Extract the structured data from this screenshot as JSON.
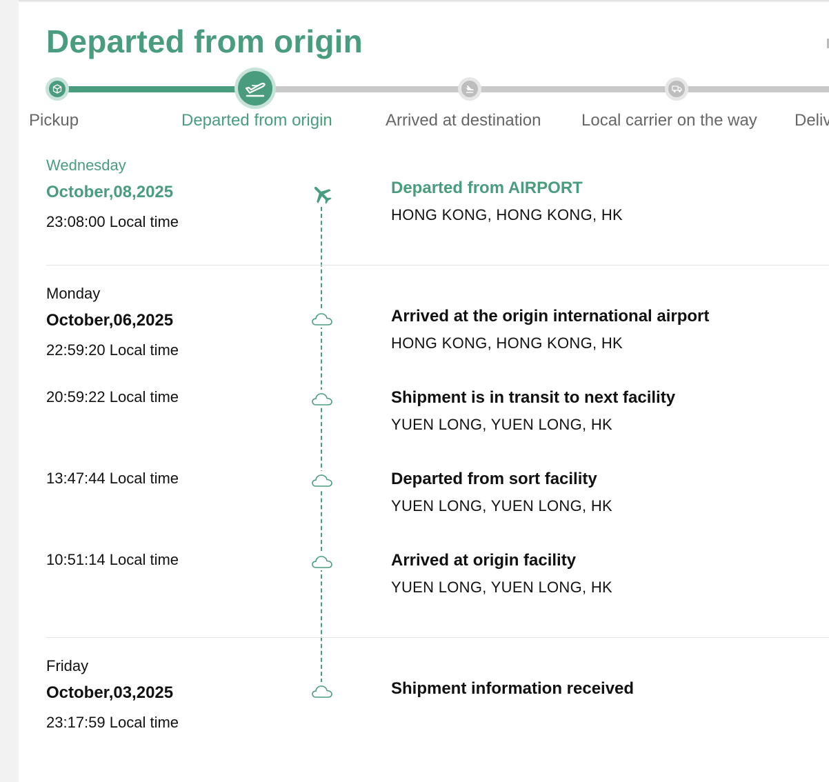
{
  "header": {
    "title": "Departed from origin"
  },
  "progress": {
    "current_step": 2,
    "steps": [
      {
        "label": "Pickup",
        "icon": "package-icon",
        "status": "done"
      },
      {
        "label": "Departed from origin",
        "icon": "plane-takeoff-icon",
        "status": "current"
      },
      {
        "label": "Arrived at destination",
        "icon": "plane-landing-icon",
        "status": "pending"
      },
      {
        "label": "Local carrier on the way",
        "icon": "truck-icon",
        "status": "pending"
      },
      {
        "label": "Deliv",
        "icon": "delivered-icon",
        "status": "pending"
      }
    ]
  },
  "timeline": {
    "groups": [
      {
        "weekday": "Wednesday",
        "date": "October,08,2025",
        "events": [
          {
            "time": "23:08:00 Local time",
            "title": "Departed from AIRPORT",
            "location": "HONG KONG, HONG KONG, HK",
            "icon": "plane-icon",
            "active": true
          }
        ]
      },
      {
        "weekday": "Monday",
        "date": "October,06,2025",
        "events": [
          {
            "time": "22:59:20 Local time",
            "title": "Arrived at the origin international airport",
            "location": "HONG KONG, HONG KONG, HK",
            "icon": "cloud-icon"
          },
          {
            "time": "20:59:22 Local time",
            "title": "Shipment is in transit to next facility",
            "location": "YUEN LONG, YUEN LONG, HK",
            "icon": "cloud-icon"
          },
          {
            "time": "13:47:44 Local time",
            "title": "Departed from sort facility",
            "location": "YUEN LONG, YUEN LONG, HK",
            "icon": "cloud-icon"
          },
          {
            "time": "10:51:14 Local time",
            "title": "Arrived at origin facility",
            "location": "YUEN LONG, YUEN LONG, HK",
            "icon": "cloud-icon"
          }
        ]
      },
      {
        "weekday": "Friday",
        "date": "October,03,2025",
        "events": [
          {
            "time": "23:17:59 Local time",
            "title": "Shipment information received",
            "location": "",
            "icon": "cloud-icon"
          }
        ]
      }
    ]
  },
  "colors": {
    "accent": "#4a9c7e",
    "accent_light": "#c7e3d9",
    "pending": "#c9c9c9",
    "text": "#111111",
    "muted": "#666666"
  }
}
